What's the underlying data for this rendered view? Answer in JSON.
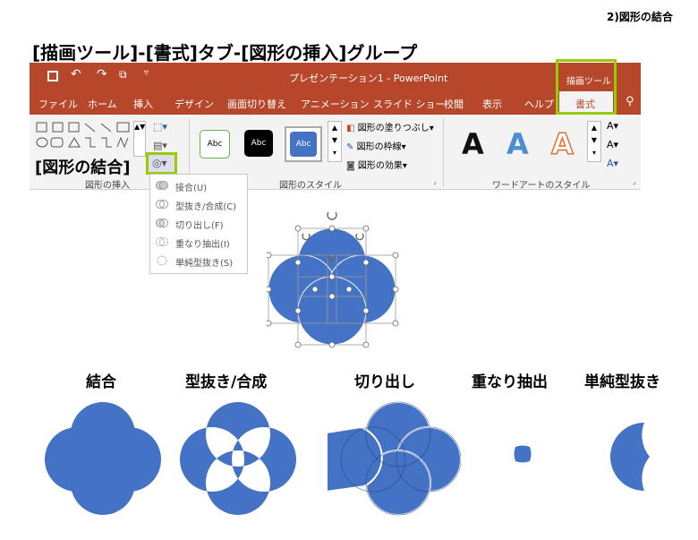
{
  "page_label": "2)図形の結合",
  "heading": "[描画ツール]-[書式]タブ-[図形の挿入]グループ",
  "titlebar": {
    "title": "プレゼンテーション1 - PowerPoint",
    "context_tab": "描画ツール"
  },
  "tabs": [
    "ファイル",
    "ホーム",
    "挿入",
    "デザイン",
    "画面切り替え",
    "アニメーション",
    "スライド ショー",
    "校閲",
    "表示",
    "ヘルプ",
    "書式"
  ],
  "ribbon": {
    "callout": "[図形の結合]",
    "groups": {
      "insert_shapes": "図形の挿入",
      "shape_styles": "図形のスタイル",
      "wordart_styles": "ワードアートのスタイル"
    },
    "style_samples": [
      "Abc",
      "Abc",
      "Abc"
    ],
    "shape_commands": [
      "図形の塗りつぶし",
      "図形の枠線",
      "図形の効果"
    ],
    "wordart_samples": [
      "A",
      "A",
      "A"
    ]
  },
  "merge_menu": {
    "items": [
      "接合(U)",
      "型抜き/合成(C)",
      "切り出し(F)",
      "重なり抽出(I)",
      "単純型抜き(S)"
    ]
  },
  "examples": [
    "結合",
    "型抜き/合成",
    "切り出し",
    "重なり抽出",
    "単純型抜き"
  ],
  "colors": {
    "accent": "#b7472a",
    "shape_blue": "#4472c4",
    "highlight_green": "#99cc00"
  }
}
